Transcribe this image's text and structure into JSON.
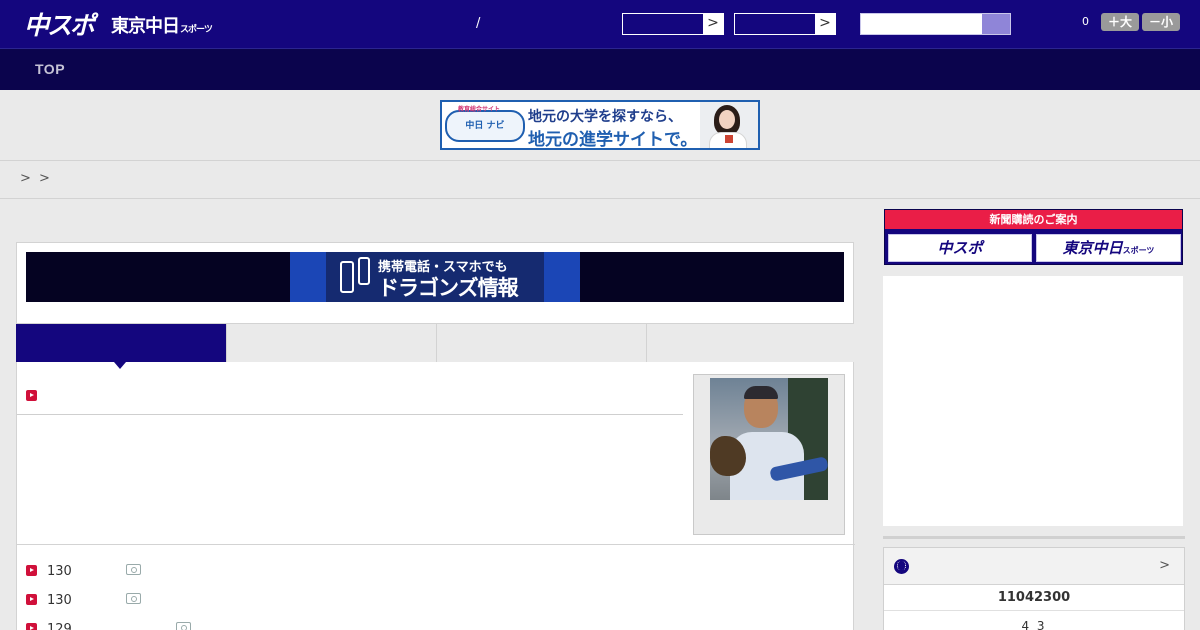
{
  "header": {
    "logo_main": "中スポ",
    "logo_sub": "東京中日",
    "logo_sub_small": "スポーツ",
    "slash": "/",
    "select_1_arrow": ">",
    "select_2_arrow": ">",
    "counter": "0",
    "font_larger": "＋大",
    "font_smaller": "－小"
  },
  "nav": {
    "top_label": "TOP"
  },
  "banner_ad": {
    "badge_small": "教育総合サイト",
    "badge": "中日 ナビ",
    "line1": "地元の大学を探すなら、",
    "line2": "地元の進学サイトで。"
  },
  "breadcrumb": {
    "text": "> >"
  },
  "dragons_banner": {
    "line1": "携帯電話・スマホでも",
    "line2": "ドラゴンズ情報"
  },
  "article_list": [
    {
      "count": "130",
      "has_photo": true
    },
    {
      "count": "130",
      "has_photo": true
    },
    {
      "count": "129",
      "has_photo": true
    }
  ],
  "subscription": {
    "heading": "新聞購読のご案内",
    "button_1": "中スポ",
    "button_2": "東京中日",
    "button_2_small": "スポーツ"
  },
  "score_panel": {
    "more": ">",
    "number": "11042300",
    "value": "4 3"
  },
  "colors": {
    "header": "#14067e",
    "nav": "#0b044d",
    "accent_red": "#d0103a",
    "subscribe_red": "#ea1e47"
  }
}
